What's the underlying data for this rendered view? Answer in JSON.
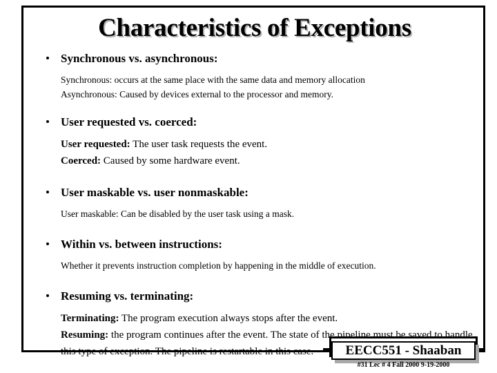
{
  "slide": {
    "title": "Characteristics of Exceptions",
    "bullets": [
      {
        "heading": "Synchronous vs.  asynchronous:",
        "sublines": [
          {
            "lead": "",
            "text": "Synchronous:  occurs at the same place with the same data and  memory allocation",
            "size": "small"
          },
          {
            "lead": "",
            "text": "Asynchronous:  Caused by devices external to the processor and memory.",
            "size": "small"
          }
        ]
      },
      {
        "heading": "User requested vs. coerced:",
        "sublines": [
          {
            "lead": "User requested:",
            "text": " The user task requests the event.",
            "size": "big"
          },
          {
            "lead": "Coerced:",
            "text": " Caused by some hardware event.",
            "size": "big"
          }
        ]
      },
      {
        "heading": "User maskable  vs.  user nonmaskable:",
        "sublines": [
          {
            "lead": "",
            "text": "User maskable: Can be disabled by the user task using a mask.",
            "size": "small"
          }
        ]
      },
      {
        "heading": "Within  vs.  between instructions:",
        "sublines": [
          {
            "lead": "",
            "text": "Whether it prevents instruction completion by happening in the  middle of execution.",
            "size": "small"
          }
        ]
      },
      {
        "heading": "Resuming  vs. terminating:",
        "sublines": [
          {
            "lead": "Terminating:",
            "text": " The program execution always stops after the event.",
            "size": "big"
          },
          {
            "lead": "Resuming:",
            "text": " the program continues after the event.  The state of the pipeline must be saved to handle this type of exception.  The pipeline is restartable in this case.",
            "size": "big"
          }
        ]
      }
    ]
  },
  "footer": {
    "course_label": "EECC551 - Shaaban",
    "meta": "#31   Lec # 4   Fall 2000  9-19-2000"
  },
  "colors": {
    "ink": "#000000",
    "page": "#ffffff",
    "shadow": "#a9a9a9",
    "title_shadow": "#b4b4b4"
  }
}
